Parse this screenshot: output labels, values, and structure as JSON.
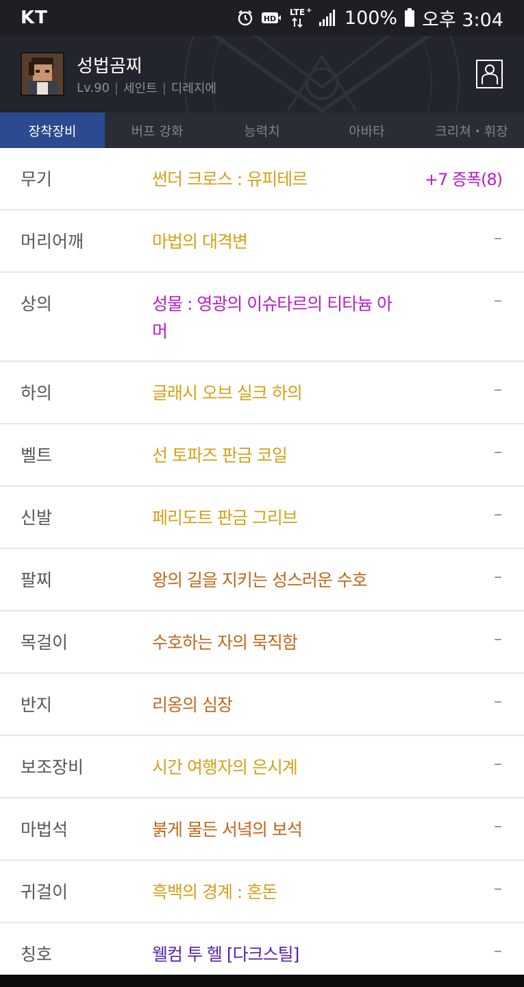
{
  "status_bar": {
    "carrier": "KT",
    "battery": "100%",
    "time": "오후 3:04",
    "icons": [
      "alarm-icon",
      "hd-icon",
      "lte-icon",
      "signal-icon",
      "battery-icon"
    ]
  },
  "character": {
    "name": "성법곰찌",
    "level": "Lv.90",
    "class": "세인트",
    "server": "디레지에"
  },
  "tabs": [
    {
      "label": "장착장비",
      "active": true
    },
    {
      "label": "버프 강화",
      "active": false
    },
    {
      "label": "능력치",
      "active": false
    },
    {
      "label": "아바타",
      "active": false
    },
    {
      "label": "크리쳐・휘장",
      "active": false
    }
  ],
  "equipment": [
    {
      "slot": "무기",
      "item": "썬더 크로스 : 유피테르",
      "color": "#d4a017",
      "extra": "+7 증폭(8)"
    },
    {
      "slot": "머리어깨",
      "item": "마법의 대격변",
      "color": "#d4a017",
      "extra": "–"
    },
    {
      "slot": "상의",
      "item": "성물 : 영광의 이슈타르의 티타늄 아머",
      "color": "#b41ec6",
      "extra": "–"
    },
    {
      "slot": "하의",
      "item": "글래시 오브 실크 하의",
      "color": "#d4a017",
      "extra": "–"
    },
    {
      "slot": "벨트",
      "item": "선 토파즈 판금 코일",
      "color": "#d4a017",
      "extra": "–"
    },
    {
      "slot": "신발",
      "item": "페리도트 판금 그리브",
      "color": "#d4a017",
      "extra": "–"
    },
    {
      "slot": "팔찌",
      "item": "왕의 길을 지키는 성스러운 수호",
      "color": "#c0661a",
      "extra": "–"
    },
    {
      "slot": "목걸이",
      "item": "수호하는 자의 묵직함",
      "color": "#c0661a",
      "extra": "–"
    },
    {
      "slot": "반지",
      "item": "리옹의 심장",
      "color": "#c0661a",
      "extra": "–"
    },
    {
      "slot": "보조장비",
      "item": "시간 여행자의 은시계",
      "color": "#d4a017",
      "extra": "–"
    },
    {
      "slot": "마법석",
      "item": "붉게 물든 서녘의 보석",
      "color": "#c0661a",
      "extra": "–"
    },
    {
      "slot": "귀걸이",
      "item": "흑백의 경계 : 혼돈",
      "color": "#d4a017",
      "extra": "–"
    },
    {
      "slot": "칭호",
      "item": "웰컴 투 헬 [다크스틸]",
      "color": "#5a1fb0",
      "extra": "–"
    }
  ]
}
